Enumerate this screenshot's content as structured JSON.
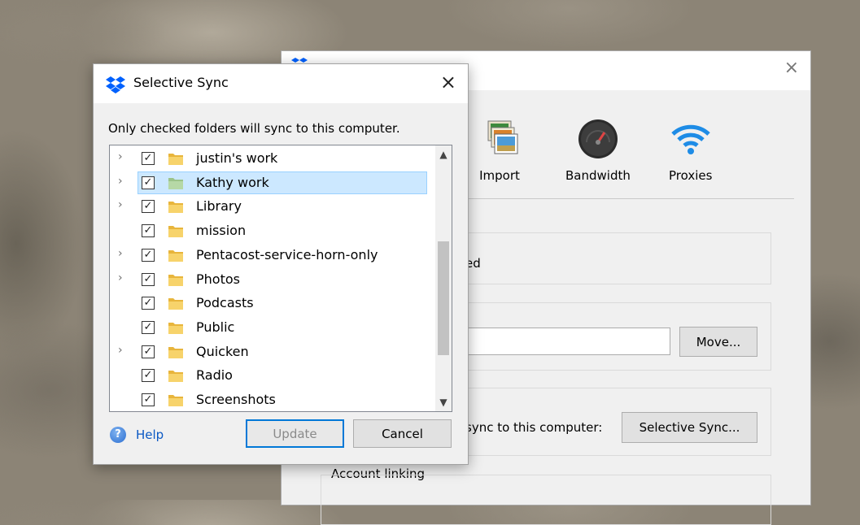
{
  "colors": {
    "accent": "#0061fe",
    "selection": "#cce8ff",
    "link": "#0a58c4"
  },
  "prefs": {
    "close_icon": "×",
    "toolbar": [
      {
        "label": "Import",
        "icon": "import-icon"
      },
      {
        "label": "Bandwidth",
        "icon": "bandwidth-gauge-icon"
      },
      {
        "label": "Proxies",
        "icon": "wifi-icon"
      }
    ],
    "status_partial": "ed",
    "move_button": "Move...",
    "sync_partial": "sync to this computer:",
    "selective_sync_button": "Selective Sync...",
    "account_linking_label": "Account linking"
  },
  "dialog": {
    "title": "Selective Sync",
    "close_icon": "×",
    "instruction": "Only checked folders will sync to this computer.",
    "folders": [
      {
        "name": "justin's work",
        "expandable": true,
        "checked": true,
        "selected": false
      },
      {
        "name": "Kathy work",
        "expandable": true,
        "checked": true,
        "selected": true
      },
      {
        "name": "Library",
        "expandable": true,
        "checked": true,
        "selected": false
      },
      {
        "name": "mission",
        "expandable": false,
        "checked": true,
        "selected": false
      },
      {
        "name": "Pentacost-service-horn-only",
        "expandable": true,
        "checked": true,
        "selected": false
      },
      {
        "name": "Photos",
        "expandable": true,
        "checked": true,
        "selected": false
      },
      {
        "name": "Podcasts",
        "expandable": false,
        "checked": true,
        "selected": false
      },
      {
        "name": "Public",
        "expandable": false,
        "checked": true,
        "selected": false
      },
      {
        "name": "Quicken",
        "expandable": true,
        "checked": true,
        "selected": false
      },
      {
        "name": "Radio",
        "expandable": false,
        "checked": true,
        "selected": false
      },
      {
        "name": "Screenshots",
        "expandable": false,
        "checked": true,
        "selected": false
      }
    ],
    "help_label": "Help",
    "update_button": "Update",
    "cancel_button": "Cancel"
  }
}
